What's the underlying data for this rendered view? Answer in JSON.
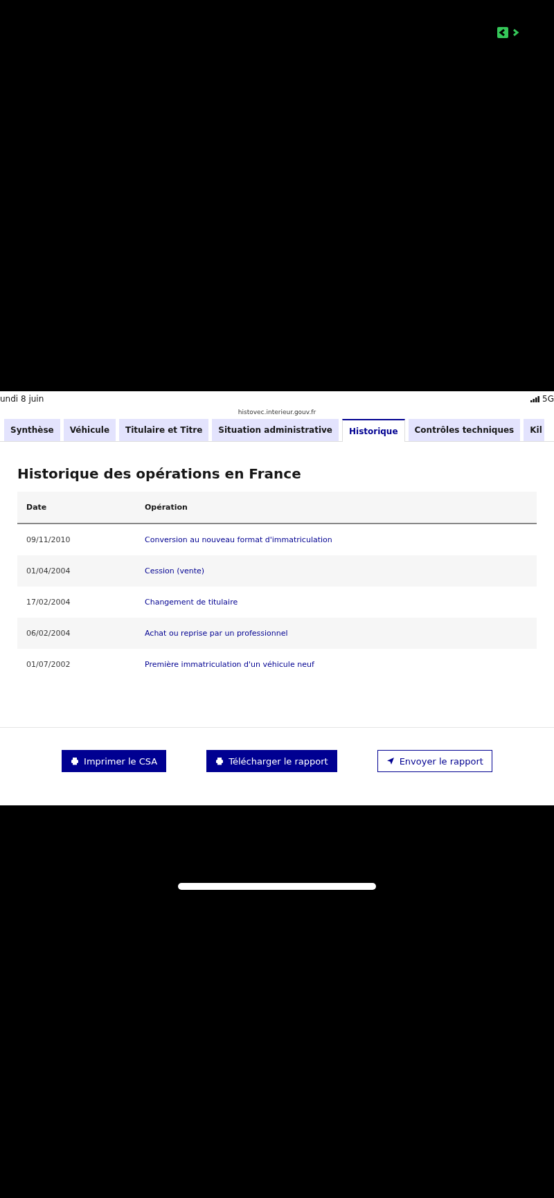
{
  "status_bar": {
    "date": "undi 8 juin",
    "network": "5G"
  },
  "address_bar": {
    "url": "histovec.interieur.gouv.fr"
  },
  "tabs": [
    {
      "label": "Synthèse",
      "selected": false
    },
    {
      "label": "Véhicule",
      "selected": false
    },
    {
      "label": "Titulaire et Titre",
      "selected": false
    },
    {
      "label": "Situation administrative",
      "selected": false
    },
    {
      "label": "Historique",
      "selected": true
    },
    {
      "label": "Contrôles techniques",
      "selected": false
    },
    {
      "label": "Kil",
      "selected": false
    }
  ],
  "section": {
    "title": "Historique des opérations en France"
  },
  "table": {
    "columns": [
      "Date",
      "Opération"
    ],
    "rows": [
      [
        "09/11/2010",
        "Conversion au nouveau format d'immatriculation"
      ],
      [
        "01/04/2004",
        "Cession (vente)"
      ],
      [
        "17/02/2004",
        "Changement de titulaire"
      ],
      [
        "06/02/2004",
        "Achat ou reprise par un professionnel"
      ],
      [
        "01/07/2002",
        "Première immatriculation d'un véhicule neuf"
      ]
    ]
  },
  "actions": [
    {
      "label": "Imprimer le CSA",
      "kind": "primary"
    },
    {
      "label": "Télécharger le rapport",
      "kind": "primary"
    },
    {
      "label": "Envoyer le rapport",
      "kind": "secondary"
    }
  ]
}
